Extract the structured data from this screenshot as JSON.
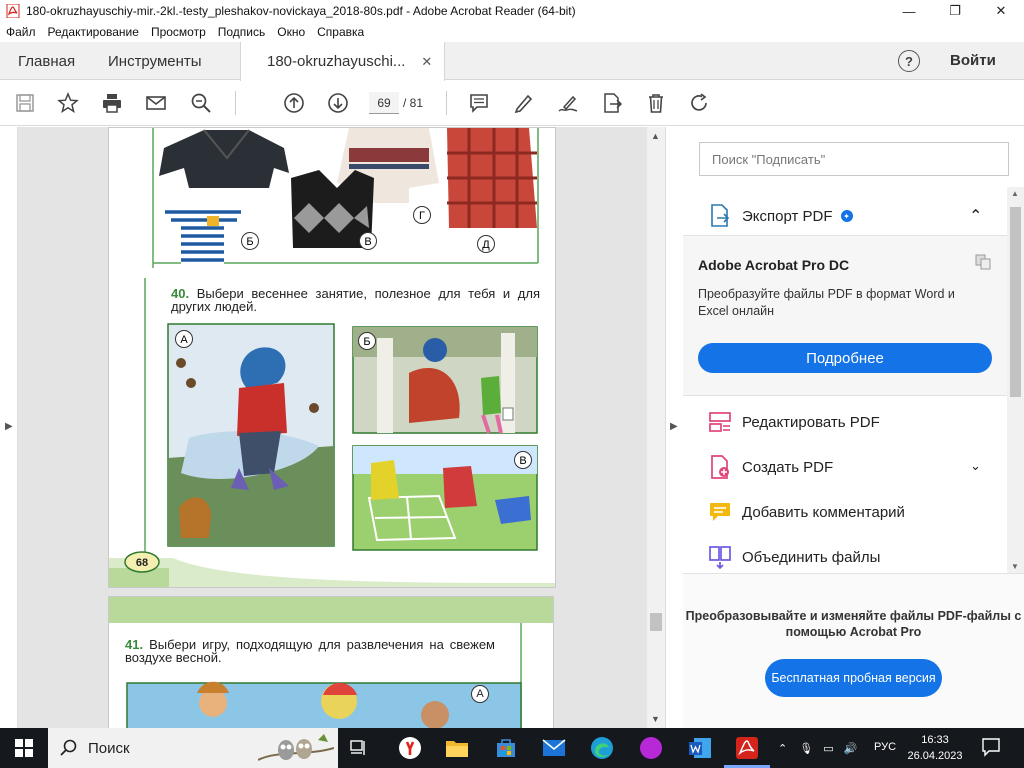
{
  "window": {
    "title": "180-okruzhayuschiy-mir.-2kl.-testy_pleshakov-novickaya_2018-80s.pdf - Adobe Acrobat Reader (64-bit)",
    "minimize": "—",
    "maximize": "❐",
    "close": "✕"
  },
  "menu": [
    "Файл",
    "Редактирование",
    "Просмотр",
    "Подпись",
    "Окно",
    "Справка"
  ],
  "tabs": {
    "home": "Главная",
    "tools": "Инструменты",
    "doc": "180-okruzhayuschi...",
    "doc_close": "✕",
    "help": "?",
    "login": "Войти"
  },
  "toolbar": {
    "page_current": "69",
    "page_total": "/ 81"
  },
  "page1": {
    "q40_num": "40.",
    "q40_text": "Выбери весеннее занятие, полезное для тебя и для других людей.",
    "labels_top": [
      "Б",
      "В",
      "Г",
      "Д"
    ],
    "labels_q40": [
      "А",
      "Б",
      "В"
    ],
    "page_number": "68"
  },
  "page2": {
    "q41_num": "41.",
    "q41_text": "Выбери игру, подходящую для развлечения на свежем воздухе весной.",
    "label_a": "А"
  },
  "right_pane": {
    "search_placeholder": "Поиск \"Подписать\"",
    "export_label": "Экспорт PDF",
    "promo_title": "Adobe Acrobat Pro DC",
    "promo_text": "Преобразуйте файлы PDF в формат Word и Excel онлайн",
    "promo_button": "Подробнее",
    "tools": [
      "Редактировать PDF",
      "Создать PDF",
      "Добавить комментарий",
      "Объединить файлы"
    ],
    "bottom_text": "Преобразовывайте и изменяйте файлы PDF-файлы с помощью Acrobat Pro",
    "bottom_button": "Бесплатная пробная версия"
  },
  "taskbar": {
    "search_label": "Поиск",
    "lang": "РУС",
    "time": "16:33",
    "date": "26.04.2023"
  },
  "colors": {
    "acrobat_red": "#d4241c",
    "adobe_blue": "#1473e6",
    "page_green": "#3b8a3b"
  }
}
